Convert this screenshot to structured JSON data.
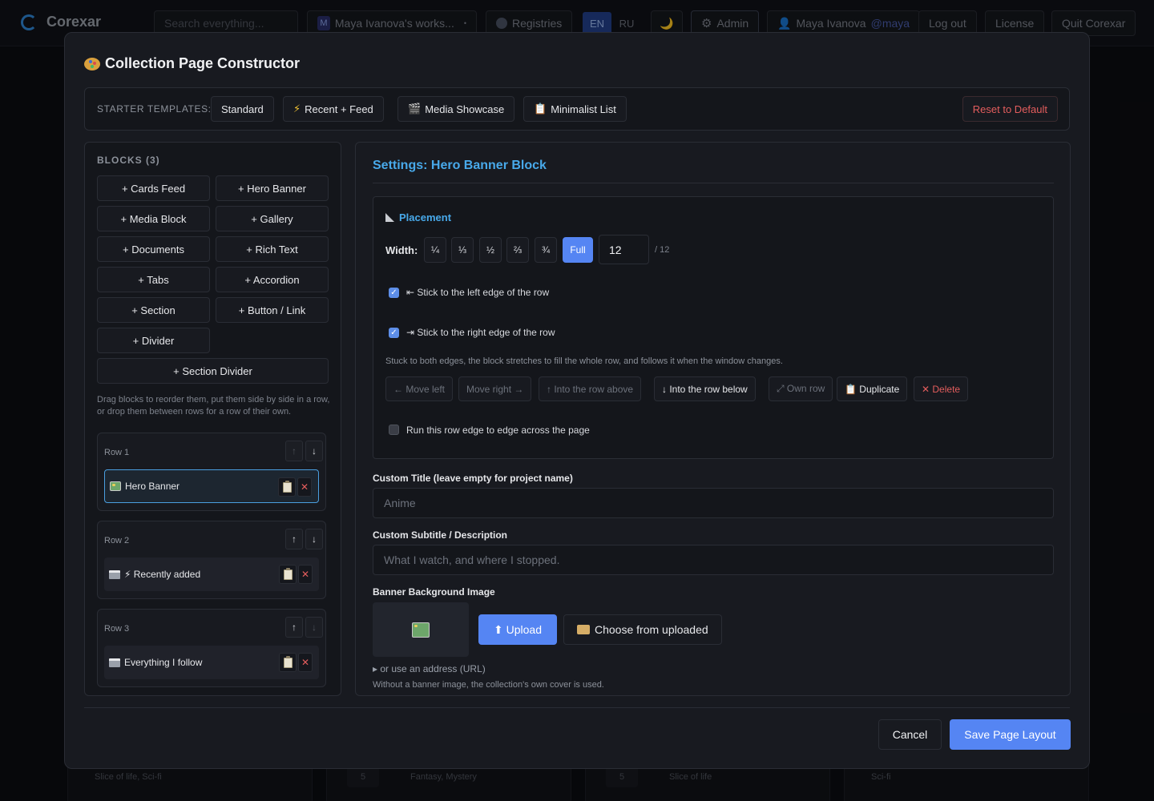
{
  "app": {
    "brand": "Corexar",
    "search_placeholder": "Search everything...",
    "workspace_badge": "M",
    "workspace": "Maya Ivanova's works...",
    "registries": "Registries",
    "lang_en": "EN",
    "lang_ru": "RU",
    "theme_icon": "🌙",
    "admin": "Admin",
    "user_name": "Maya Ivanova",
    "user_handle": "@maya",
    "logout": "Log out",
    "license": "License",
    "quit": "Quit Corexar"
  },
  "background": {
    "cards": [
      {
        "tags": "Slice of life, Sci-fi"
      },
      {
        "num": "5",
        "tags": "Fantasy, Mystery"
      },
      {
        "num": "5",
        "tags": "Slice of life"
      },
      {
        "tags": "Sci-fi"
      }
    ]
  },
  "modal": {
    "title": "Collection Page Constructor",
    "templates_label": "STARTER TEMPLATES:",
    "templates": [
      {
        "icon": "",
        "label": "Standard"
      },
      {
        "icon": "⚡",
        "label": "Recent + Feed"
      },
      {
        "icon": "🎬",
        "label": "Media Showcase"
      },
      {
        "icon": "📋",
        "label": "Minimalist List"
      }
    ],
    "reset": "Reset to Default",
    "blocks_title": "BLOCKS (3)",
    "add_blocks": [
      "+ Cards Feed",
      "+ Hero Banner",
      "+ Media Block",
      "+ Gallery",
      "+ Documents",
      "+ Rich Text",
      "+ Tabs",
      "+ Accordion",
      "+ Section",
      "+ Button / Link",
      "+ Divider",
      "+ Section Divider"
    ],
    "hint": "Drag blocks to reorder them, put them side by side in a row, or drop them between rows for a row of their own.",
    "rows": [
      {
        "label": "Row 1",
        "item": "Hero Banner",
        "icon": "image"
      },
      {
        "label": "Row 2",
        "item": "⚡ Recently added",
        "icon": "clapper"
      },
      {
        "label": "Row 3",
        "item": "Everything I follow",
        "icon": "clapper"
      }
    ],
    "settings_title": "Settings: Hero Banner Block",
    "placement": {
      "title": "Placement",
      "width_label": "Width:",
      "width_options": [
        "¼",
        "⅓",
        "½",
        "⅔",
        "¾",
        "Full"
      ],
      "width_value": "12",
      "width_max": "/ 12",
      "stick_left": "⇤ Stick to the left edge of the row",
      "stick_right": "⇥ Stick to the right edge of the row",
      "note": "Stuck to both edges, the block stretches to fill the whole row, and follows it when the window changes.",
      "actions": [
        "← Move left",
        "Move right →",
        "↑ Into the row above",
        "↓ Into the row below",
        "⤢ Own row",
        "📋 Duplicate",
        "✕ Delete"
      ],
      "full_row": "Run this row edge to edge across the page"
    },
    "custom_title_label": "Custom Title (leave empty for project name)",
    "custom_title_value": "Anime",
    "subtitle_label": "Custom Subtitle / Description",
    "subtitle_value": "What I watch, and where I stopped.",
    "banner_label": "Banner Background Image",
    "upload": "⬆ Upload",
    "choose": "Choose from uploaded",
    "url_link": "▸ or use an address (URL)",
    "banner_note": "Without a banner image, the collection's own cover is used.",
    "cancel": "Cancel",
    "save": "Save Page Layout"
  },
  "colors": {
    "accent": "#5585f3",
    "title_blue": "#48a9ea",
    "danger": "#e35d5d",
    "selected_border": "#4a9fe0"
  }
}
